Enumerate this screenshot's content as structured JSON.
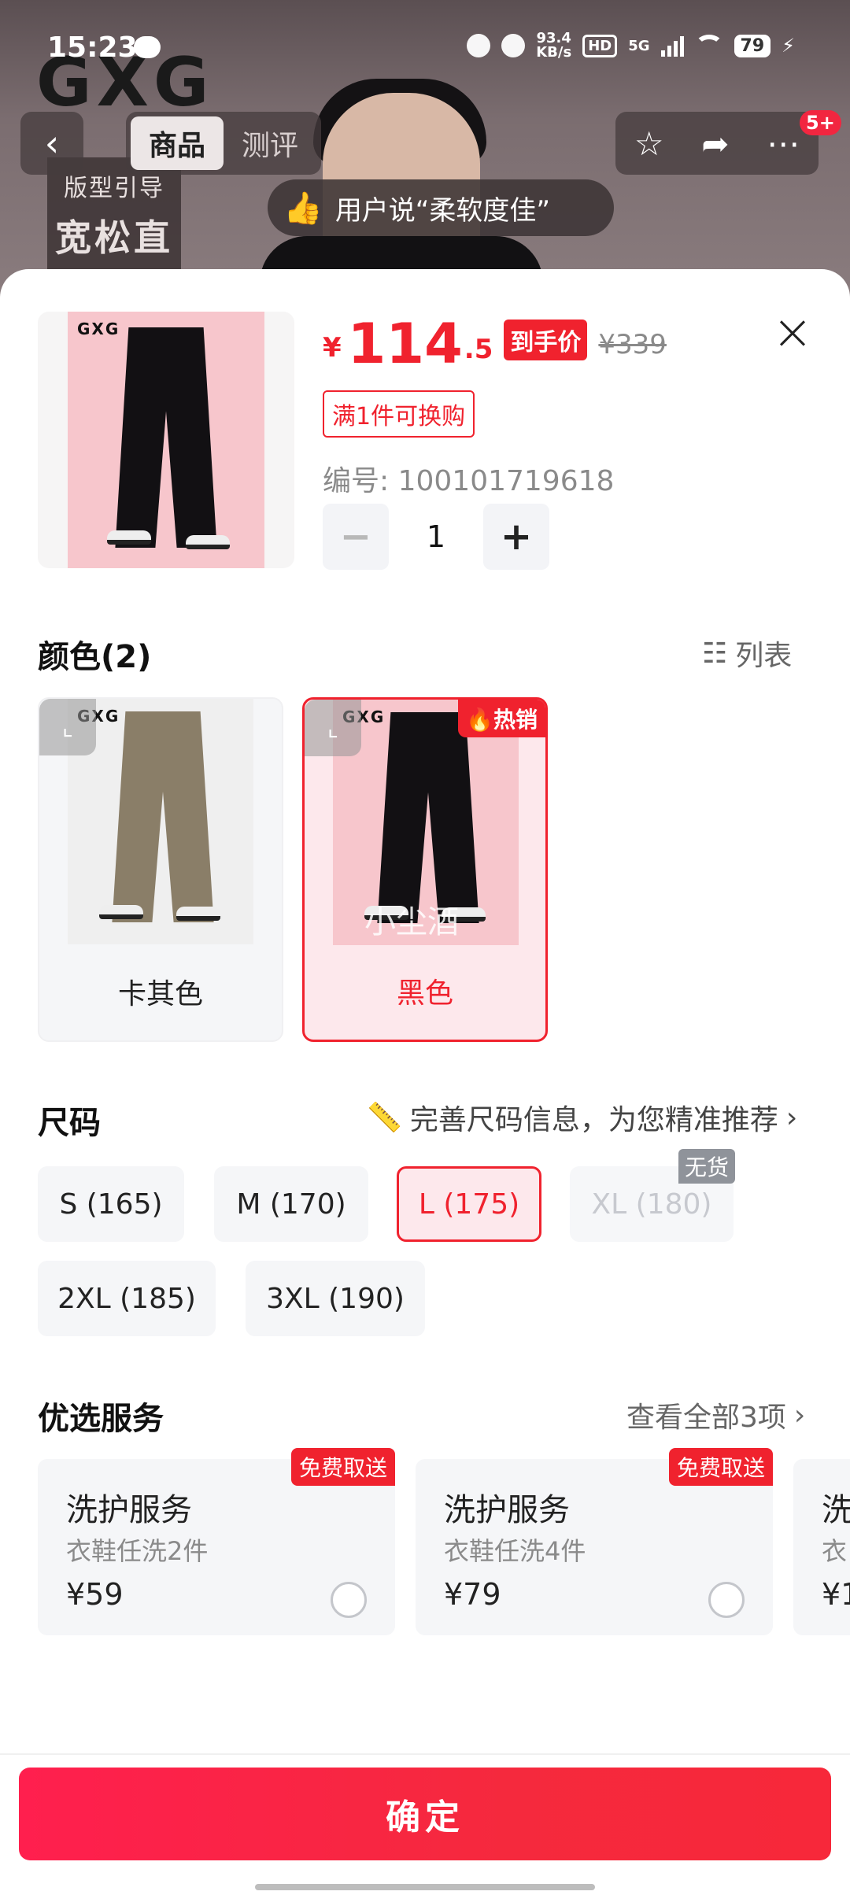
{
  "status_bar": {
    "time": "15:23",
    "net_speed": "93.4",
    "net_unit": "KB/s",
    "hd": "HD",
    "network": "5G",
    "battery": "79"
  },
  "backdrop": {
    "brand_logo": "GXG",
    "guide_label": "版型引导",
    "guide_value": "宽松直筒",
    "tabs": [
      "商品",
      "测评"
    ],
    "badge": "5+",
    "review_text": "用户说“柔软度佳”"
  },
  "product": {
    "currency": "¥",
    "price_int": "114",
    "price_dec": ".5",
    "price_tag": "到手价",
    "orig_price": "¥339",
    "swap_tag": "满1件可换购",
    "sku": "编号: 100101719618",
    "quantity": "1",
    "minus": "−",
    "plus": "+",
    "thumb_brand": "GXG"
  },
  "color_section": {
    "title": "颜色(2)",
    "list_view": "列表",
    "options": [
      {
        "label": "卡其色",
        "brand": "GXG"
      },
      {
        "label": "黑色",
        "brand": "GXG",
        "tag": "热销",
        "watermark": "小尘酒"
      }
    ]
  },
  "size_section": {
    "title": "尺码",
    "hint": "完善尺码信息，为您精准推荐",
    "options": [
      "S (165)",
      "M (170)",
      "L (175)",
      "XL (180)",
      "2XL (185)",
      "3XL (190)"
    ],
    "selected": "L (175)",
    "out_of_stock_label": "无货"
  },
  "service_section": {
    "title": "优选服务",
    "view_all": "查看全部3项",
    "cards": [
      {
        "title": "洗护服务",
        "sub": "衣鞋任洗2件",
        "price": "¥59",
        "badge": "免费取送"
      },
      {
        "title": "洗护服务",
        "sub": "衣鞋任洗4件",
        "price": "¥79",
        "badge": "免费取送"
      },
      {
        "title": "洗",
        "sub": "衣",
        "price": "¥1"
      }
    ]
  },
  "footer": {
    "confirm": "确定"
  },
  "colors": {
    "accent": "#f0222e",
    "selected_bg": "#fde8ec",
    "chip_bg": "#f5f6f8"
  }
}
